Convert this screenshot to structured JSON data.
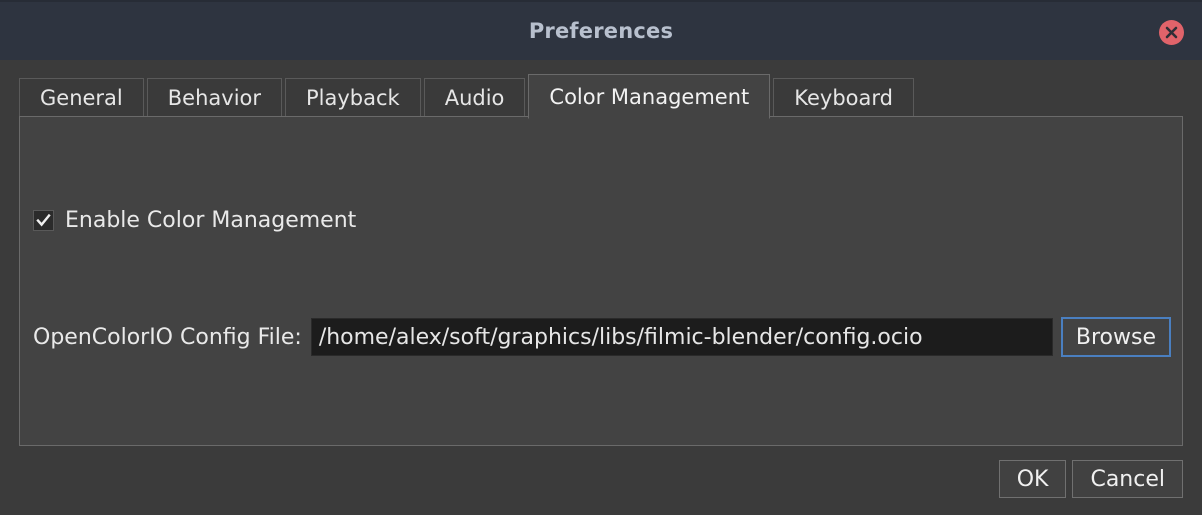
{
  "window": {
    "title": "Preferences",
    "close_icon": "close-icon"
  },
  "tabs": [
    {
      "label": "General",
      "selected": false
    },
    {
      "label": "Behavior",
      "selected": false
    },
    {
      "label": "Playback",
      "selected": false
    },
    {
      "label": "Audio",
      "selected": false
    },
    {
      "label": "Color Management",
      "selected": true
    },
    {
      "label": "Keyboard",
      "selected": false
    }
  ],
  "panel": {
    "enable_color_management": {
      "label": "Enable Color Management",
      "checked": true
    },
    "config_file": {
      "label": "OpenColorIO Config File:",
      "value": "/home/alex/soft/graphics/libs/filmic-blender/config.ocio",
      "placeholder": "",
      "browse_label": "Browse"
    }
  },
  "footer": {
    "ok_label": "OK",
    "cancel_label": "Cancel"
  },
  "colors": {
    "titlebar": "#2e3440",
    "body": "#3b3b3b",
    "panel": "#434343",
    "tab": "#3a3a3a",
    "close": "#e0636a",
    "focus": "#4a7fc0",
    "input_bg": "#1c1c1c",
    "text": "#e9e9e9"
  }
}
